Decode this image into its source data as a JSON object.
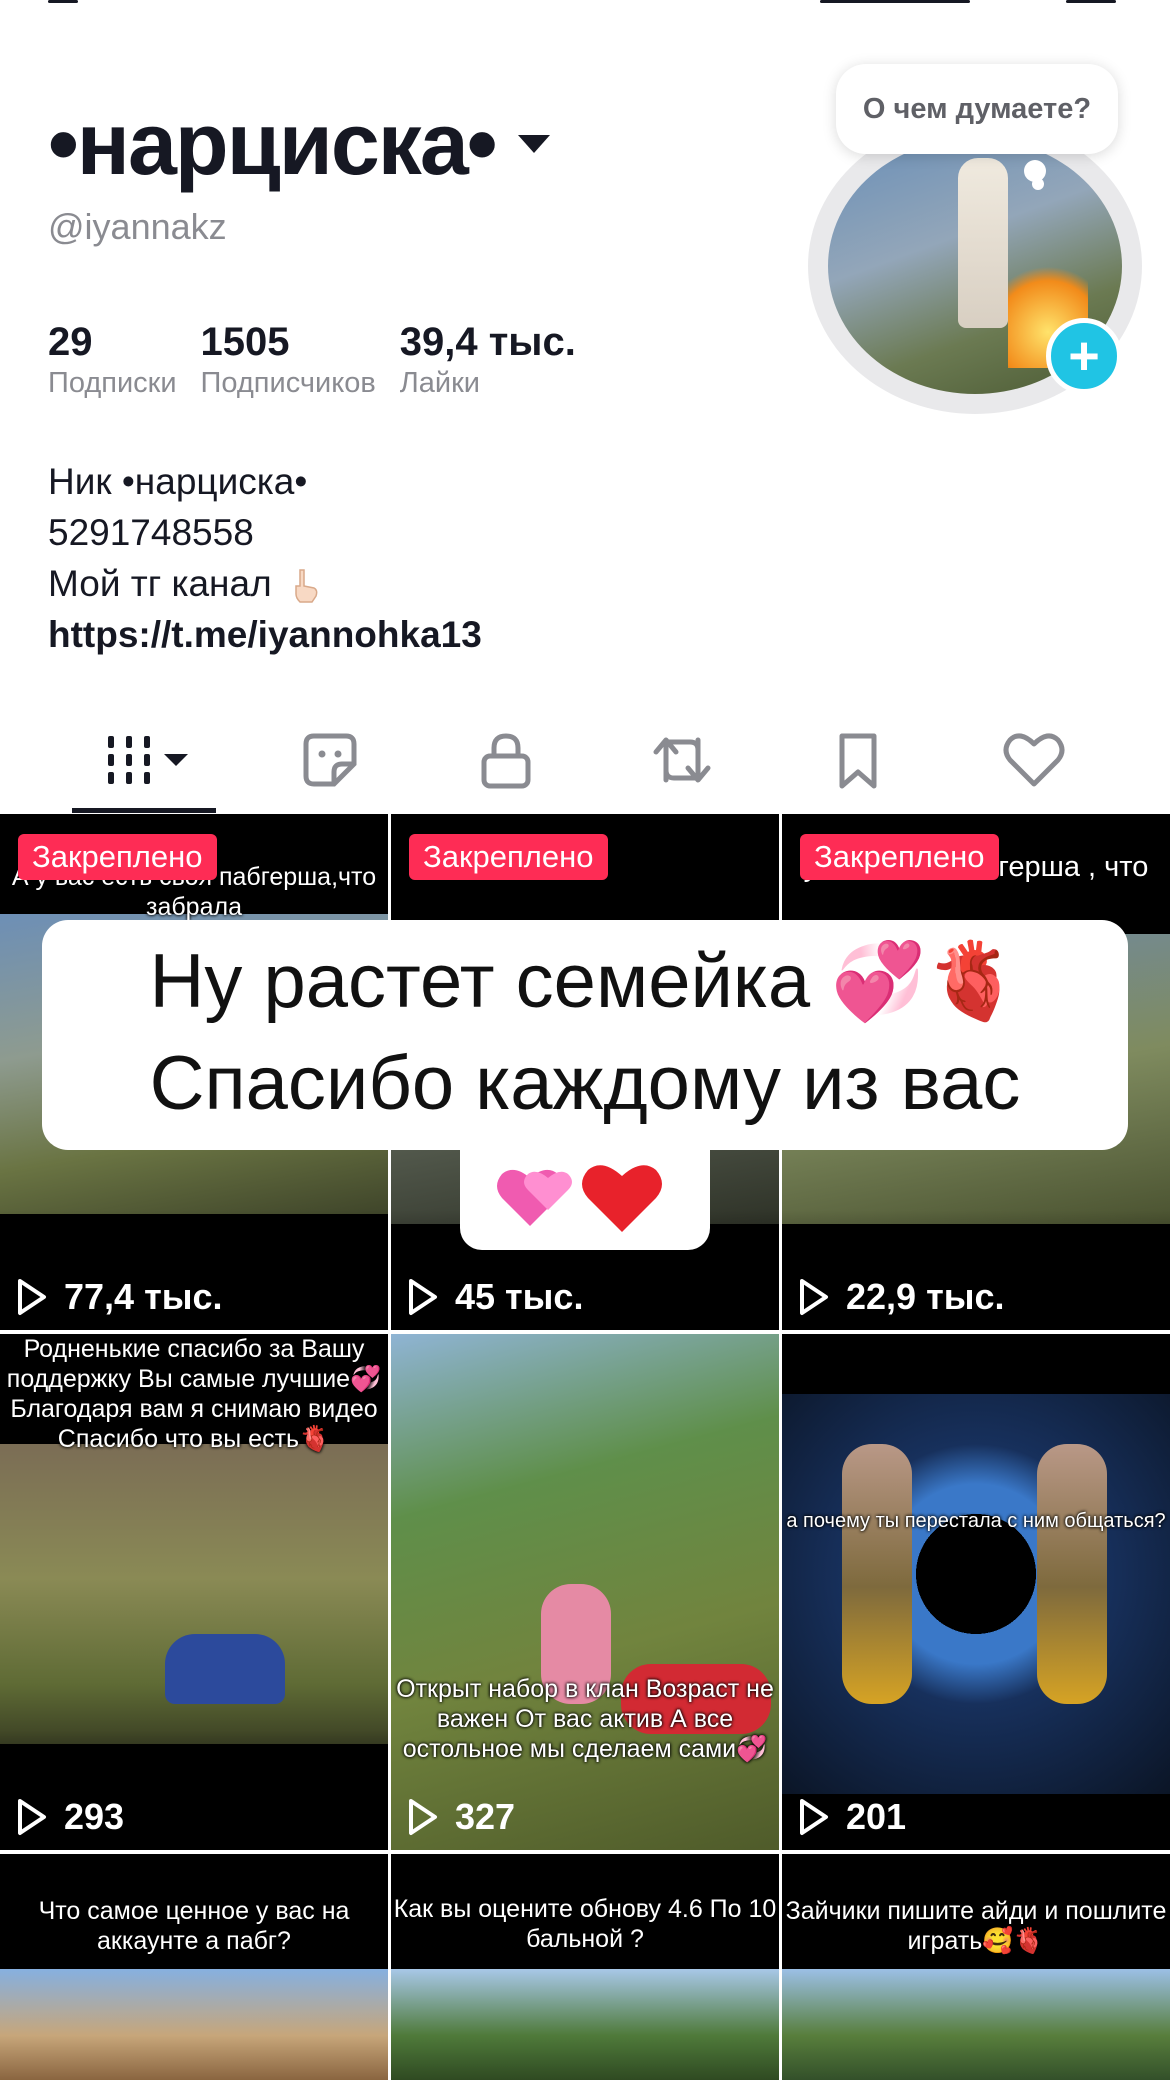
{
  "profile": {
    "display_name": "•нарциска•",
    "username": "@iyannakz",
    "stats": [
      {
        "value": "29",
        "label": "Подписки"
      },
      {
        "value": "1505",
        "label": "Подписчиков"
      },
      {
        "value": "39,4 тыс.",
        "label": "Лайки"
      }
    ],
    "bio": {
      "line1": "Ник •нарциска•",
      "line2": "5291748558",
      "line3": "Мой тг канал",
      "link": "https://t.me/iyannohka13"
    },
    "thought_bubble": "О чем думаете?",
    "add_button": "+"
  },
  "tabs": [
    {
      "name": "videos",
      "icon": "grid-icon",
      "active": true
    },
    {
      "name": "stickers",
      "icon": "sticker-icon"
    },
    {
      "name": "private",
      "icon": "lock-icon"
    },
    {
      "name": "reposts",
      "icon": "repost-icon"
    },
    {
      "name": "favorites",
      "icon": "bookmark-icon"
    },
    {
      "name": "liked",
      "icon": "heart-icon"
    }
  ],
  "pinned_label": "Закреплено",
  "videos": [
    {
      "views": "77,4 тыс.",
      "pinned": true,
      "caption": "А у вас есть своя пабгерша,что забрала"
    },
    {
      "views": "45 тыс.",
      "pinned": true,
      "caption": ""
    },
    {
      "views": "22,9 тыс.",
      "pinned": true,
      "caption": "у вас Есть пабгерша , что"
    },
    {
      "views": "293",
      "pinned": false,
      "caption": "Родненькие спасибо за Вашу поддержку Вы самые лучшие💞 Благодаря вам я снимаю видео Спасибо что вы есть🫀"
    },
    {
      "views": "327",
      "pinned": false,
      "caption": "Открыт набор в клан Возраст не важен От вас актив А все остольное мы сделаем сами💞"
    },
    {
      "views": "201",
      "pinned": false,
      "caption": "а почему ты перестала с ним общаться?"
    },
    {
      "views": "",
      "pinned": false,
      "caption": "Что самое ценное у вас на аккаунте а пабг?"
    },
    {
      "views": "",
      "pinned": false,
      "caption": "Как вы оцените обнову 4.6 По 10 бальной ?"
    },
    {
      "views": "",
      "pinned": false,
      "caption": "Зайчики пишите айди и пошлите играть🥰🫀"
    }
  ],
  "overlay": {
    "line1": "Ну растет семейка 💞🫀",
    "line2": "Спасибо каждому из вас",
    "line3": "💞❤️"
  },
  "colors": {
    "accent_red": "#fe2c55",
    "accent_cyan": "#20c4e4",
    "muted_text": "#8a8b91"
  }
}
